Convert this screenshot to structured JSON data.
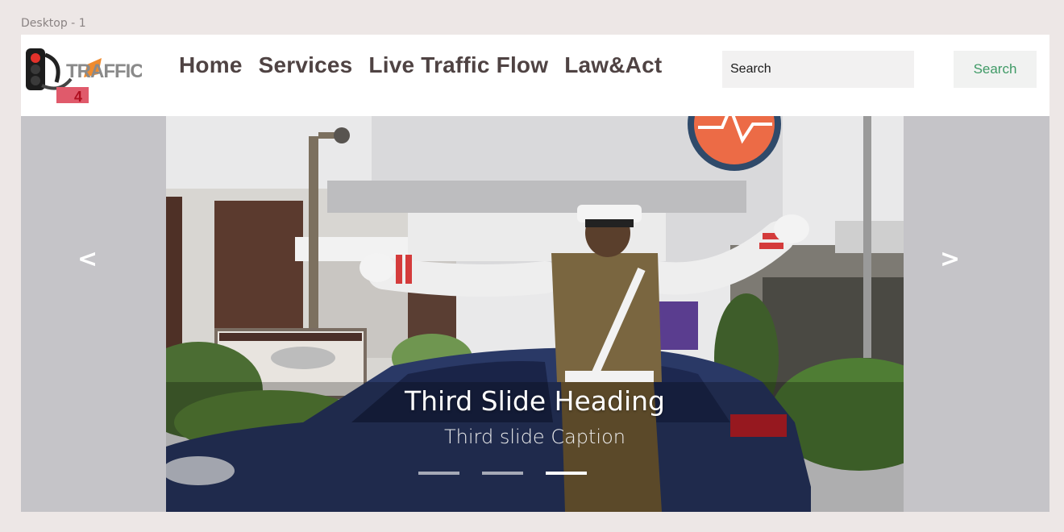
{
  "frame_label": "Desktop - 1",
  "logo": {
    "text": "TRAFFIC",
    "badge": "4"
  },
  "nav": {
    "links": [
      "Home",
      "Services",
      "Live Traffic Flow",
      "Law&Act"
    ]
  },
  "search": {
    "placeholder": "Search",
    "button_label": "Search"
  },
  "carousel": {
    "prev_label": "<",
    "next_label": ">",
    "slide_heading": "Third Slide Heading",
    "slide_caption": "Third slide Caption",
    "slide_count": 3,
    "active_index": 2
  },
  "colors": {
    "frame_bg": "#ede7e6",
    "nav_text": "#4f4343",
    "search_button_text": "#3f9a66",
    "carousel_bg": "#c5c4c8"
  }
}
